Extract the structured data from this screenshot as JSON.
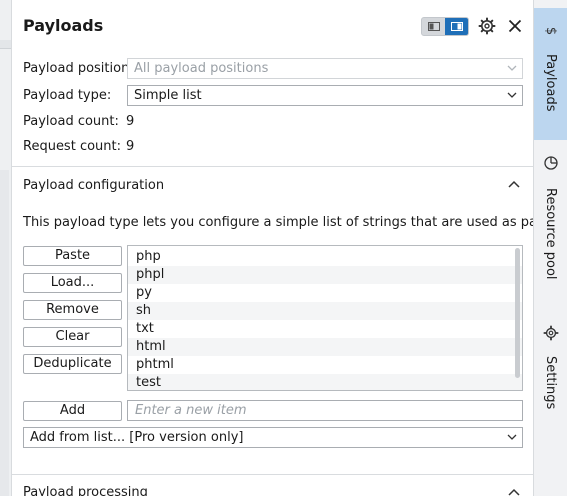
{
  "panel": {
    "title": "Payloads"
  },
  "fields": {
    "payload_position_label": "Payload position:",
    "payload_position_value": "All payload positions",
    "payload_type_label": "Payload type:",
    "payload_type_value": "Simple list",
    "payload_count_label": "Payload count:",
    "payload_count_value": "9",
    "request_count_label": "Request count:",
    "request_count_value": "9"
  },
  "config": {
    "title": "Payload configuration",
    "description": "This payload type lets you configure a simple list of strings that are used as payloads.",
    "buttons": {
      "paste": "Paste",
      "load": "Load...",
      "remove": "Remove",
      "clear": "Clear",
      "deduplicate": "Deduplicate",
      "add": "Add"
    },
    "items": [
      "php",
      "phpl",
      "py",
      "sh",
      "txt",
      "html",
      "phtml",
      "test"
    ],
    "add_placeholder": "Enter a new item",
    "add_from_list": "Add from list... [Pro version only]"
  },
  "processing": {
    "title": "Payload processing"
  },
  "right_tabs": {
    "payloads": "Payloads",
    "resource_pool": "Resource pool",
    "settings": "Settings"
  },
  "colors": {
    "accent": "#1f6fb8",
    "active_tab": "#bcd6ef"
  }
}
